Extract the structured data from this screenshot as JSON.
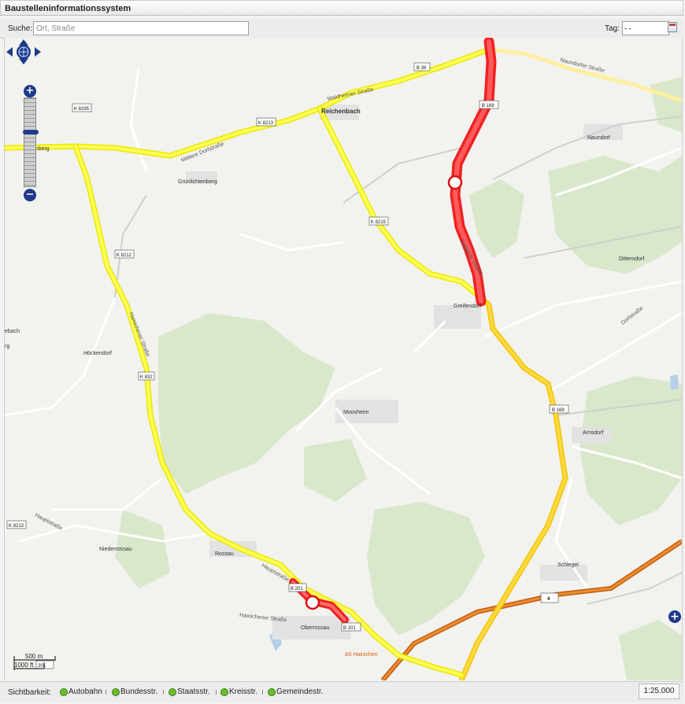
{
  "app": {
    "title": "Baustelleninformationssystem"
  },
  "toolbar": {
    "search_label": "Suche:",
    "search_placeholder": "Ort, Straße",
    "day_label": "Tag:",
    "day_value": "- -"
  },
  "map": {
    "places": [
      {
        "name": "Reichenbach"
      },
      {
        "name": "Ehrenberg"
      },
      {
        "name": "Grünlichtenberg"
      },
      {
        "name": "Naundorf"
      },
      {
        "name": "Dittersdorf"
      },
      {
        "name": "Greifendorf"
      },
      {
        "name": "Höckendorf"
      },
      {
        "name": "Moosheim"
      },
      {
        "name": "Arnsdorf"
      },
      {
        "name": "Niederrossau"
      },
      {
        "name": "Rossau"
      },
      {
        "name": "Oberrossau"
      },
      {
        "name": "Schlegel"
      },
      {
        "name": "ebach"
      },
      {
        "name": "rg"
      }
    ],
    "streets": [
      {
        "name": "Naundorfer Straße"
      },
      {
        "name": "Waldheimer Straße"
      },
      {
        "name": "Mittlere Dorfstraße"
      },
      {
        "name": "Döbelner Straße"
      },
      {
        "name": "Dorfstraße"
      },
      {
        "name": "Hainichener Straße"
      },
      {
        "name": "Hauptstraße"
      },
      {
        "name": "Hainichener Straße"
      },
      {
        "name": "Hauptstraße"
      },
      {
        "name": "A5 Hainichen"
      }
    ],
    "shields": [
      {
        "label": "B 169"
      },
      {
        "label": "B 36"
      },
      {
        "label": "K 8295"
      },
      {
        "label": "K 8213"
      },
      {
        "label": "K 8212"
      },
      {
        "label": "K 8213"
      },
      {
        "label": "K 8215"
      },
      {
        "label": "B 169"
      },
      {
        "label": "K 832"
      },
      {
        "label": "B 201"
      },
      {
        "label": "B 201"
      },
      {
        "label": "201"
      },
      {
        "label": "4"
      }
    ],
    "construction_sites": [
      {
        "road": "B 169 Döbelner Straße",
        "status": "red"
      },
      {
        "road": "Hauptstraße Rossau",
        "status": "red"
      }
    ],
    "scale": {
      "metric": "500 m",
      "imperial": "1000 ft"
    },
    "colors": {
      "construction": "#ff3b3b",
      "detour": "#ffff33",
      "federal_road": "#ffd633",
      "autobahn": "#d9680f",
      "forest": "#d7e6c8",
      "water": "#b5d0e8"
    }
  },
  "controls": {
    "zoom_in": "+",
    "zoom_out": "−",
    "layer_switcher": "+"
  },
  "statusbar": {
    "visibility_label": "Sichtbarkeit:",
    "layers": [
      {
        "label": "Autobahn",
        "checked": true
      },
      {
        "label": "Bundesstr.",
        "checked": true
      },
      {
        "label": "Staatsstr.",
        "checked": true
      },
      {
        "label": "Kreisstr.",
        "checked": true
      },
      {
        "label": "Gemeindestr.",
        "checked": true
      }
    ],
    "scale": "1:25.000"
  }
}
